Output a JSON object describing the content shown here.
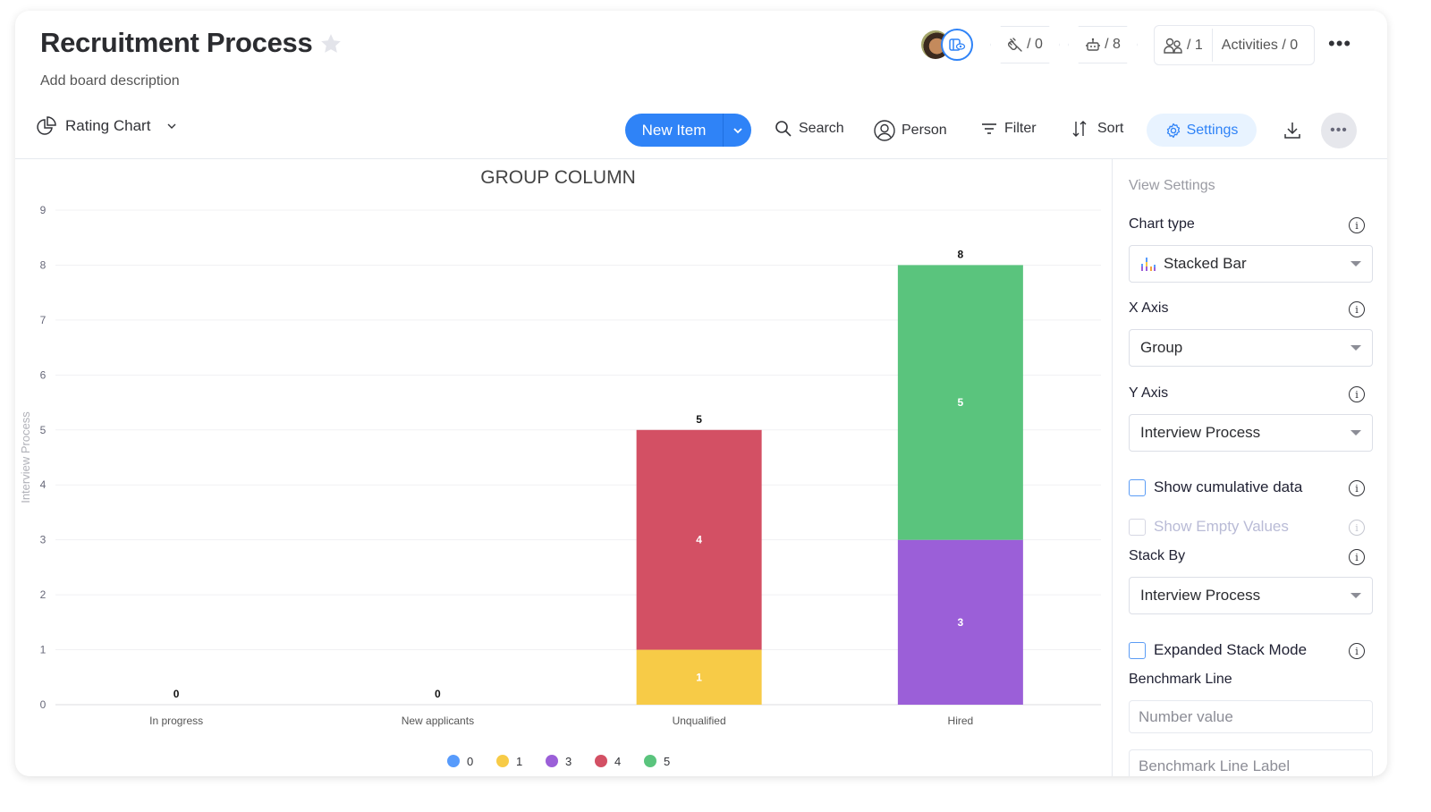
{
  "board": {
    "title": "Recruitment Process",
    "description": "Add board description"
  },
  "header": {
    "integrations_count": "/ 0",
    "automations_count": "/ 8",
    "members_count": "/ 1",
    "activities_label": "Activities / 0"
  },
  "toolbar": {
    "view_name": "Rating Chart",
    "new_item_label": "New Item",
    "search_label": "Search",
    "person_label": "Person",
    "filter_label": "Filter",
    "sort_label": "Sort",
    "settings_label": "Settings",
    "colors": {
      "primary": "#2f83f7",
      "settings_bg": "#e8f3ff"
    }
  },
  "settings_panel": {
    "heading": "View Settings",
    "chart_type_label": "Chart type",
    "chart_type_value": "Stacked Bar",
    "x_axis_label": "X Axis",
    "x_axis_value": "Group",
    "y_axis_label": "Y Axis",
    "y_axis_value": "Interview Process",
    "show_cumulative_label": "Show cumulative data",
    "show_cumulative_checked": false,
    "show_empty_label": "Show Empty Values",
    "show_empty_checked": false,
    "stack_by_label": "Stack By",
    "stack_by_value": "Interview Process",
    "expanded_stack_label": "Expanded Stack Mode",
    "expanded_stack_checked": false,
    "benchmark_label": "Benchmark Line",
    "benchmark_value_placeholder": "Number value",
    "benchmark_label_placeholder": "Benchmark Line Label"
  },
  "chart_data": {
    "type": "bar",
    "stacked": true,
    "title": "GROUP COLUMN",
    "xlabel": "",
    "ylabel": "Interview Process",
    "ylim": [
      0,
      9
    ],
    "yticks": [
      0,
      1,
      2,
      3,
      4,
      5,
      6,
      7,
      8,
      9
    ],
    "grid": true,
    "legend_position": "bottom",
    "categories": [
      "In progress",
      "New applicants",
      "Unqualified",
      "Hired"
    ],
    "totals": [
      0,
      0,
      5,
      8
    ],
    "series": [
      {
        "name": "0",
        "color": "#579bfc",
        "values": [
          0,
          0,
          0,
          0
        ]
      },
      {
        "name": "1",
        "color": "#f7cb47",
        "values": [
          0,
          0,
          1,
          0
        ]
      },
      {
        "name": "3",
        "color": "#9b5fd8",
        "values": [
          0,
          0,
          0,
          3
        ]
      },
      {
        "name": "4",
        "color": "#d35064",
        "values": [
          0,
          0,
          4,
          0
        ]
      },
      {
        "name": "5",
        "color": "#5ac47d",
        "values": [
          0,
          0,
          0,
          5
        ]
      }
    ]
  }
}
